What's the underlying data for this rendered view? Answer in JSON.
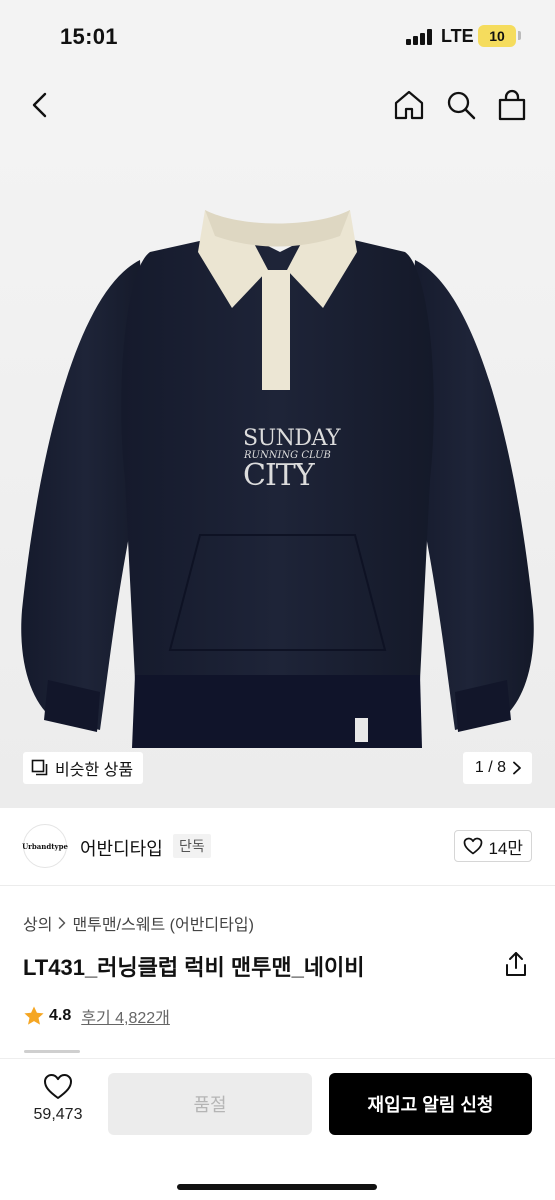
{
  "status_bar": {
    "time": "15:01",
    "network": "LTE",
    "battery": "10",
    "battery_color": "#f5dc5d"
  },
  "nav": {
    "back_icon": "chevron-left-icon",
    "home_icon": "home-icon",
    "search_icon": "search-icon",
    "cart_icon": "shopping-bag-icon"
  },
  "product_image": {
    "print_line1": "SUNDAY",
    "print_line2": "RUNNING CLUB",
    "print_line3": "CITY",
    "similar_label": "비슷한 상품",
    "image_counter": "1 / 8"
  },
  "brand": {
    "logo_text": "Urbandtype",
    "name": "어반디타입",
    "badge": "단독",
    "likes": "14만"
  },
  "breadcrumb": {
    "category": "상의",
    "subcategory": "맨투맨/스웨트 (어반디타입)"
  },
  "product": {
    "title": "LT431_러닝클럽 럭비 맨투맨_네이비",
    "rating": "4.8",
    "reviews_label": "후기 4,822개",
    "star_color": "#f5a623"
  },
  "bottom_bar": {
    "wish_count": "59,473",
    "soldout_label": "품절",
    "restock_label": "재입고 알림 신청"
  }
}
